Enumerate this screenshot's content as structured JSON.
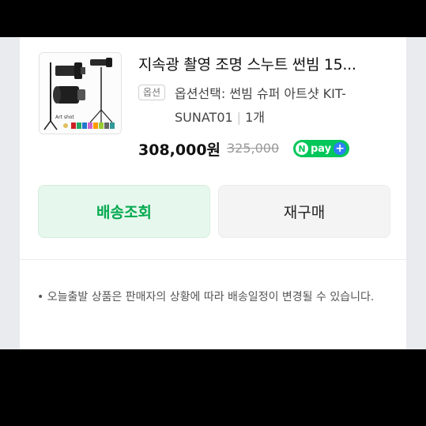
{
  "product": {
    "title": "지속광 촬영 조명 스누트 썬빔 15...",
    "option_badge": "옵션",
    "option_text": "옵션선택: 썬빔 슈퍼 아트샷 KIT-SUNAT01",
    "quantity": "1개",
    "price": "308,000원",
    "original_price": "325,000",
    "pay_label": "pay",
    "pay_n": "N",
    "pay_plus": "+",
    "thumb_tag": "Art shot"
  },
  "actions": {
    "track_label": "배송조회",
    "rebuy_label": "재구매"
  },
  "notice": {
    "bullet": "•",
    "text": "오늘출발 상품은 판매자의 상황에 따라 배송일정이 변경될 수 있습니다."
  },
  "colors": {
    "brand_green": "#03c75a",
    "track_bg": "#e6f7ed",
    "track_text": "#03a94f",
    "plus_blue": "#2d7ef7"
  }
}
